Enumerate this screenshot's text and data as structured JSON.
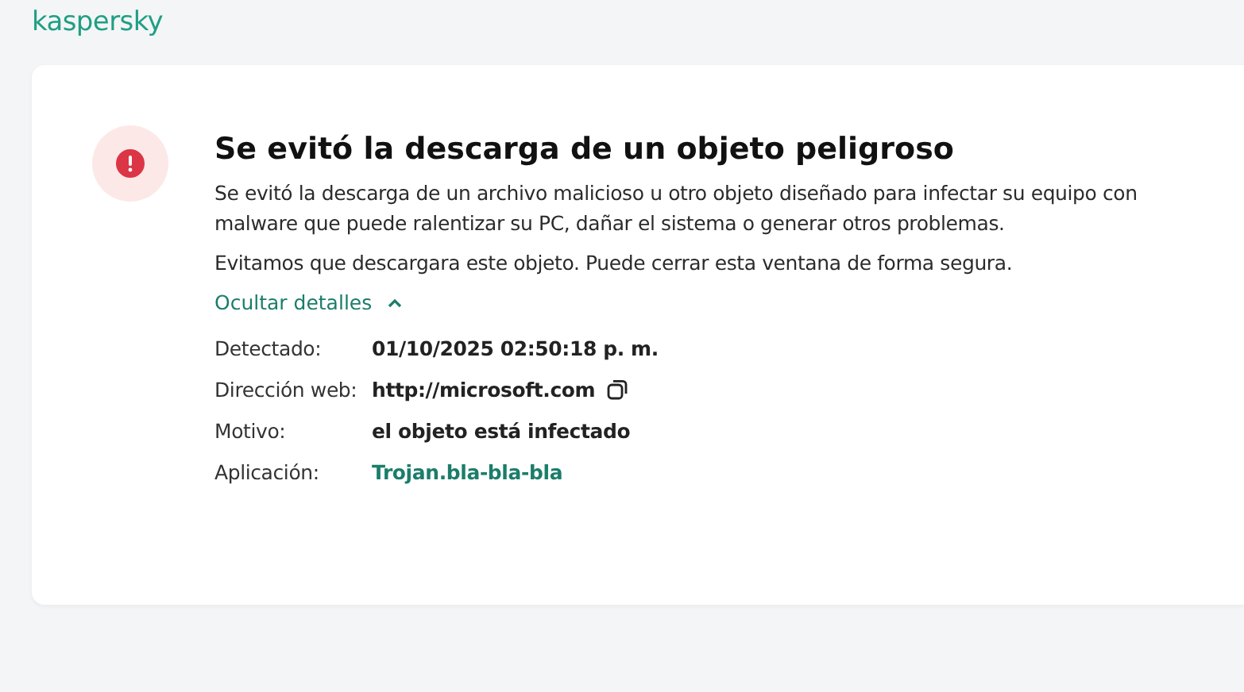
{
  "logo": "kaspersky",
  "alert": {
    "title": "Se evitó la descarga de un objeto peligroso",
    "description": "Se evitó la descarga de un archivo malicioso u otro objeto diseñado para infectar su equipo con malware que puede ralentizar su PC, dañar el sistema o generar otros problemas.",
    "note": "Evitamos que descargara este objeto. Puede cerrar esta ventana de forma segura.",
    "details_toggle": {
      "label": "Ocultar detalles",
      "expanded": true
    },
    "details": [
      {
        "label": "Detectado:",
        "value": "01/10/2025 02:50:18 p. m.",
        "kind": "plain"
      },
      {
        "label": "Dirección web:",
        "value": "http://microsoft.com",
        "kind": "copy"
      },
      {
        "label": "Motivo:",
        "value": "el objeto está infectado",
        "kind": "plain"
      },
      {
        "label": "Aplicación:",
        "value": "Trojan.bla-bla-bla",
        "kind": "link"
      }
    ]
  }
}
